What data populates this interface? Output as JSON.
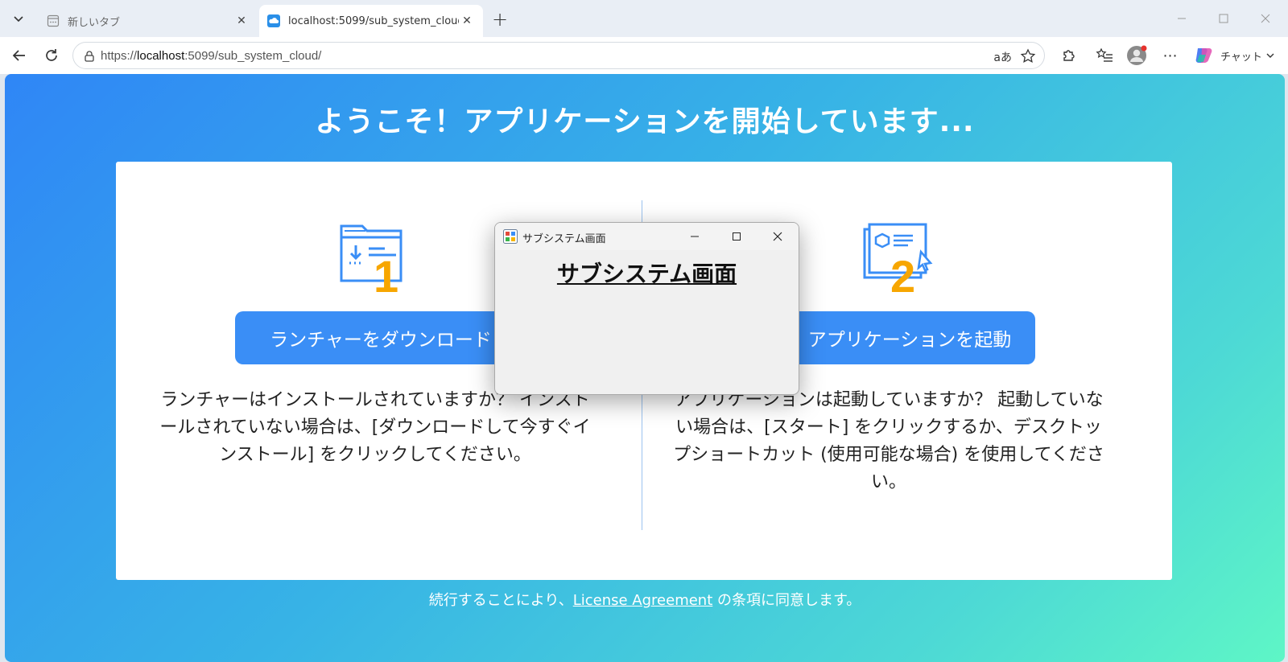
{
  "browser": {
    "tabs": [
      {
        "title": "新しいタブ",
        "active": false
      },
      {
        "title": "localhost:5099/sub_system_cloud/",
        "active": true
      }
    ],
    "address_bar": {
      "url_prefix": "https://",
      "url_host": "localhost",
      "url_rest": ":5099/sub_system_cloud/"
    },
    "copilot_label": "チャット",
    "new_tab_symbol": "+",
    "read_aloud_label": "aあ"
  },
  "page": {
    "headline": "ようこそ！アプリケーションを開始しています...",
    "step1": {
      "number": "1",
      "button_label": "ランチャーをダウンロード",
      "description": "ランチャーはインストールされていますか？ インストールされていない場合は、[ダウンロードして今すぐインストール] をクリックしてください。"
    },
    "step2": {
      "number": "2",
      "button_label": "アプリケーションを起動",
      "description": "アプリケーションは起動していますか？ 起動していない場合は、[スタート] をクリックするか、デスクトップショートカット (使用可能な場合) を使用してください。"
    },
    "footer": {
      "before": "続行することにより、",
      "link": "License Agreement",
      "after": " の条項に同意します。"
    },
    "colors": {
      "accent": "#3a8ef6",
      "step_number": "#f7a600",
      "gradient_start": "#2f86f6",
      "gradient_end": "#5ef6c6"
    }
  },
  "dialog": {
    "window_title": "サブシステム画面",
    "heading": "サブシステム画面"
  }
}
